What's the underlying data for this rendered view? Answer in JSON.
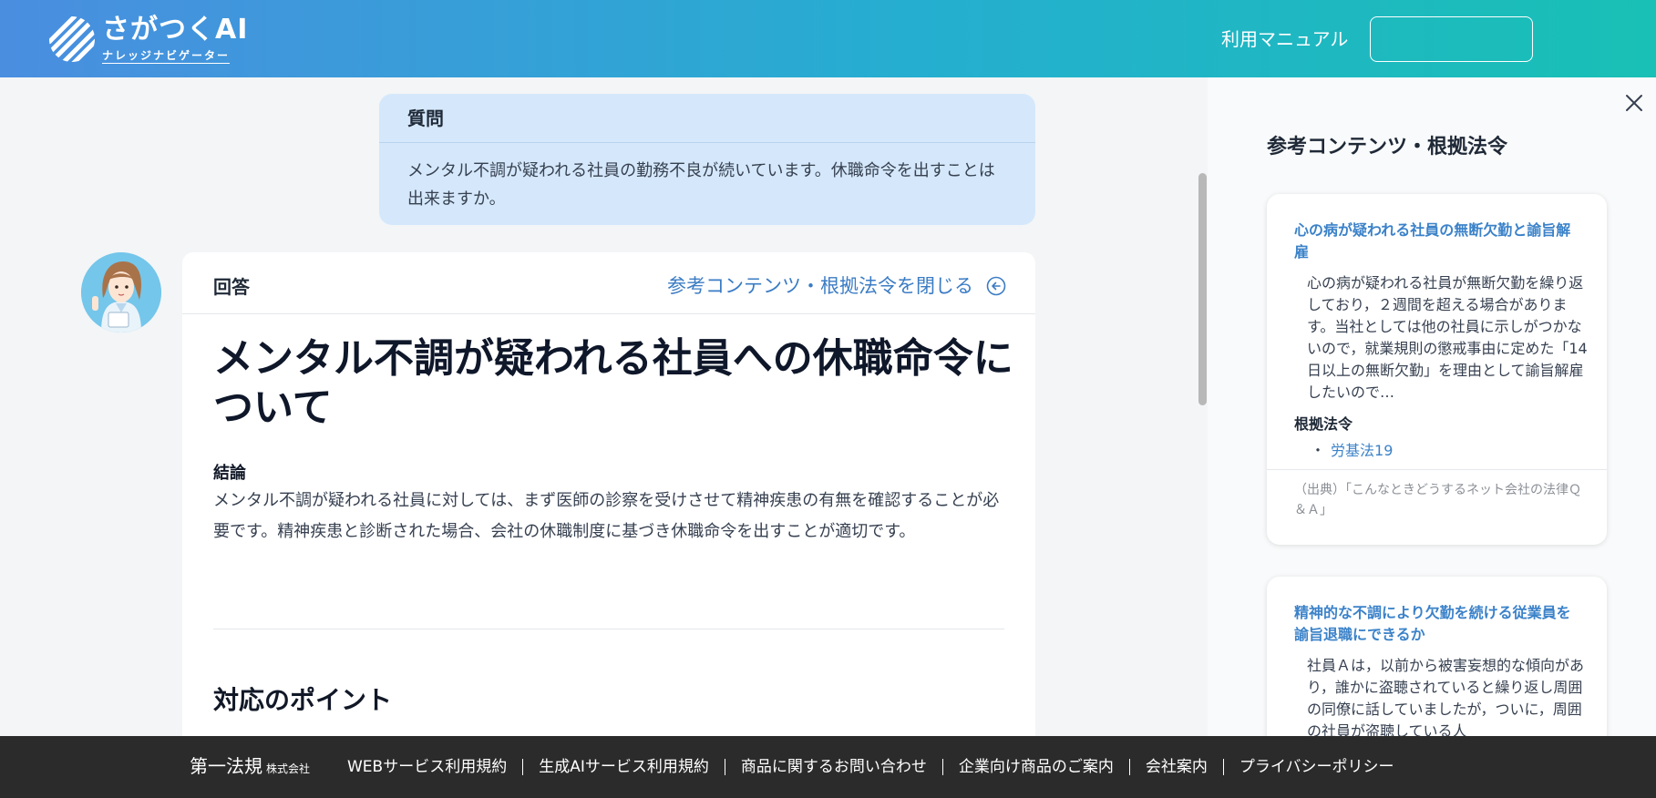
{
  "header": {
    "logo_main": "さがつくAI",
    "logo_sub": "ナレッジナビゲーター",
    "manual_link": "利用マニュアル",
    "button_label": ""
  },
  "question": {
    "label": "質問",
    "text": "メンタル不調が疑われる社員の勤務不良が続いています。休職命令を出すことは出来ますか。"
  },
  "answer": {
    "label": "回答",
    "close_link": "参考コンテンツ・根拠法令を閉じる",
    "title": "メンタル不調が疑われる社員への休職命令について",
    "conclusion_label": "結論",
    "conclusion_text": "メンタル不調が疑われる社員に対しては、まず医師の診察を受けさせて精神疾患の有無を確認することが必要です。精神疾患と診断された場合、会社の休職制度に基づき休職命令を出すことが適切です。",
    "points_heading": "対応のポイント"
  },
  "panel": {
    "title": "参考コンテンツ・根拠法令",
    "cards": [
      {
        "title": "心の病が疑われる社員の無断欠勤と諭旨解雇",
        "text": "心の病が疑われる社員が無断欠勤を繰り返しており，２週間を超える場合があります。当社としては他の社員に示しがつかないので，就業規則の懲戒事由に定めた「14日以上の無断欠勤」を理由として諭旨解雇したいので…",
        "law_label": "根拠法令",
        "law_bullet": "・",
        "law_link": "労基法19",
        "source": "（出典）「こんなときどうするネット会社の法律Ｑ＆Ａ」"
      },
      {
        "title": "精神的な不調により欠勤を続ける従業員を諭旨退職にできるか",
        "text": "社員Ａは，以前から被害妄想的な傾向があり，誰かに盗聴されていると繰り返し周囲の同僚に話していましたが，ついに，周囲の社員が盗聴している人"
      }
    ]
  },
  "footer": {
    "logo": "第一法規",
    "logo_suffix": "株式会社",
    "links": [
      "WEBサービス利用規約",
      "生成AIサービス利用規約",
      "商品に関するお問い合わせ",
      "企業向け商品のご案内",
      "会社案内",
      "プライバシーポリシー"
    ]
  },
  "colors": {
    "header_gradient_start": "#4a8ee0",
    "header_gradient_end": "#19c0b5",
    "link_blue": "#3b82c9",
    "question_bg": "#d5e8fb",
    "footer_bg": "#2b2b2b"
  }
}
